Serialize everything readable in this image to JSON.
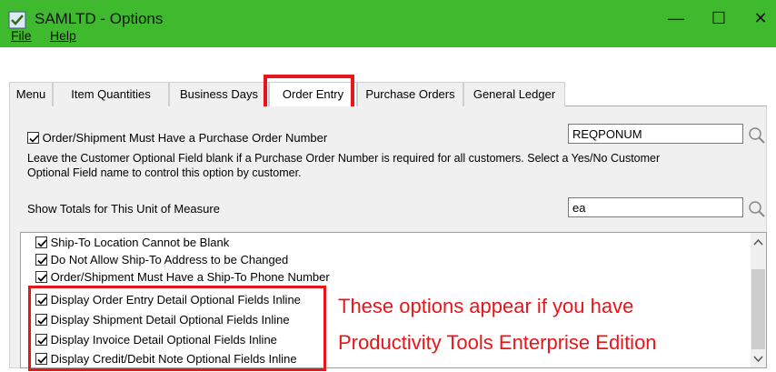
{
  "window": {
    "title": "SAMLTD - Options",
    "controls": [
      "—",
      "☐",
      "✕"
    ],
    "accent_color": "#3fba2e"
  },
  "menu": [
    {
      "label": "File",
      "underline": "F"
    },
    {
      "label": "Help",
      "underline": "H"
    }
  ],
  "tabs": [
    "Menu",
    "Item Quantities",
    "Business Days",
    "Order Entry",
    "Purchase Orders",
    "General Ledger"
  ],
  "active_tab": "Order Entry",
  "options": {
    "po_required_label": "Order/Shipment Must Have a Purchase Order Number",
    "po_required_checked": true,
    "po_field_value": "REQPONUM",
    "po_help_line1": "Leave the Customer Optional Field blank if a Purchase Order Number is required for all customers. Select a Yes/No Customer",
    "po_help_line2": "Optional Field name to control this option by customer.",
    "uom_label": "Show Totals for This Unit of Measure",
    "uom_value": "ea"
  },
  "list_items": [
    {
      "label": "Ship-To Location Cannot be Blank",
      "checked": true
    },
    {
      "label": "Do Not Allow Ship-To Address to be Changed",
      "checked": true
    },
    {
      "label": "Order/Shipment Must Have a Ship-To Phone Number",
      "checked": true
    },
    {
      "label": "Display Order Entry Detail Optional Fields Inline",
      "checked": true
    },
    {
      "label": "Display Shipment Detail Optional Fields Inline",
      "checked": true
    },
    {
      "label": "Display Invoice Detail Optional Fields Inline",
      "checked": true
    },
    {
      "label": "Display Credit/Debit Note Optional Fields Inline",
      "checked": true
    }
  ],
  "callout": {
    "line1": "These options appear if you have",
    "line2": "Productivity Tools Enterprise Edition",
    "color": "#e8151b"
  },
  "icons": [
    "app-check-icon",
    "minimize-icon",
    "maximize-icon",
    "close-icon",
    "magnifier-icon",
    "scroll-up-icon",
    "scroll-down-icon"
  ]
}
